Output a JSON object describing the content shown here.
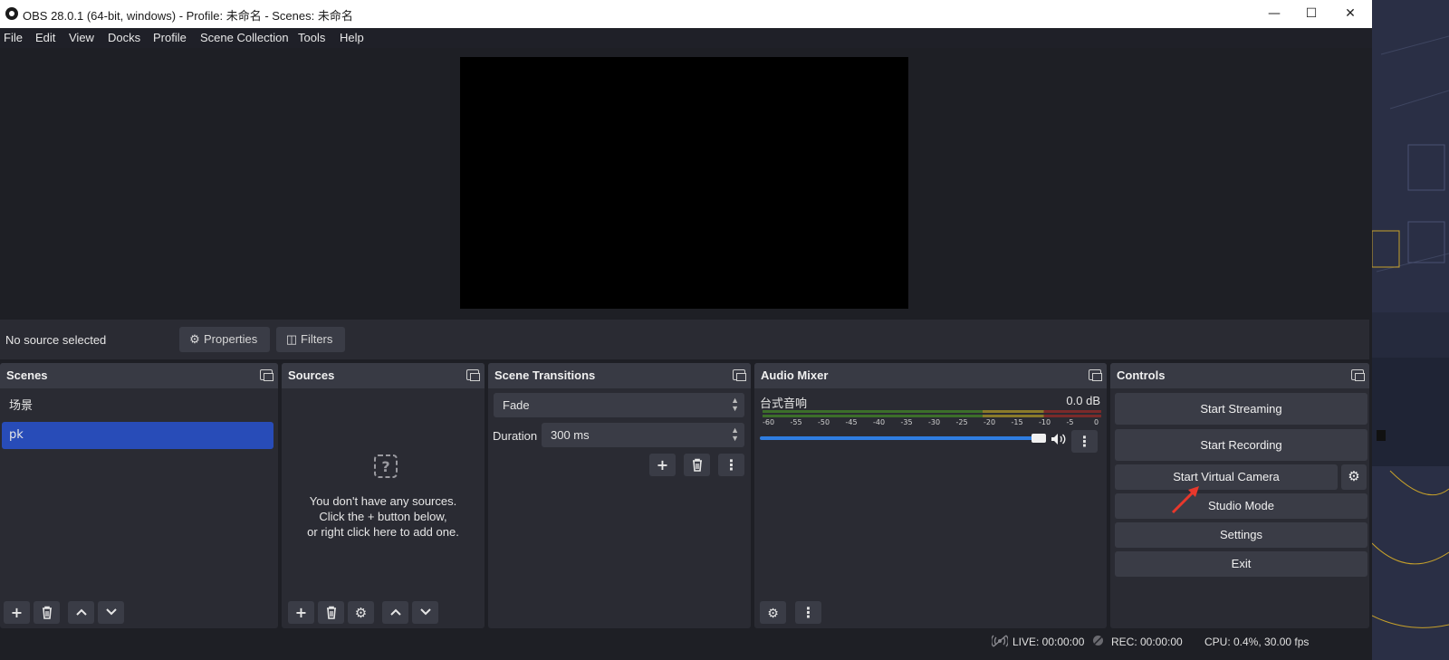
{
  "window": {
    "title": "OBS 28.0.1 (64-bit, windows) - Profile: 未命名 - Scenes: 未命名",
    "minimize_icon": "minimize-icon",
    "maximize_icon": "maximize-icon",
    "close_icon": "close-icon"
  },
  "menu": [
    "File",
    "Edit",
    "View",
    "Docks",
    "Profile",
    "Scene Collection",
    "Tools",
    "Help"
  ],
  "context_bar": {
    "status": "No source selected",
    "properties_label": "Properties",
    "filters_label": "Filters"
  },
  "scenes": {
    "title": "Scenes",
    "items": [
      "场景",
      "pk"
    ],
    "selected_index": 1
  },
  "sources": {
    "title": "Sources",
    "empty_line1": "You don't have any sources.",
    "empty_line2": "Click the + button below,",
    "empty_line3": "or right click here to add one."
  },
  "transitions": {
    "title": "Scene Transitions",
    "selected": "Fade",
    "duration_label": "Duration",
    "duration_value": "300 ms"
  },
  "audio_mixer": {
    "title": "Audio Mixer",
    "channel_name": "台式音响",
    "channel_db": "0.0 dB",
    "meter_ticks": [
      "-60",
      "-55",
      "-50",
      "-45",
      "-40",
      "-35",
      "-30",
      "-25",
      "-20",
      "-15",
      "-10",
      "-5",
      "0"
    ],
    "volume_fraction": 1.0
  },
  "controls": {
    "title": "Controls",
    "start_streaming": "Start Streaming",
    "start_recording": "Start Recording",
    "start_virtual_camera": "Start Virtual Camera",
    "studio_mode": "Studio Mode",
    "settings": "Settings",
    "exit": "Exit"
  },
  "status_bar": {
    "live": "LIVE: 00:00:00",
    "rec": "REC: 00:00:00",
    "cpu": "CPU: 0.4%, 30.00 fps"
  },
  "colors": {
    "accent_selected": "#284cb8",
    "annotation_arrow": "#e8382c"
  }
}
